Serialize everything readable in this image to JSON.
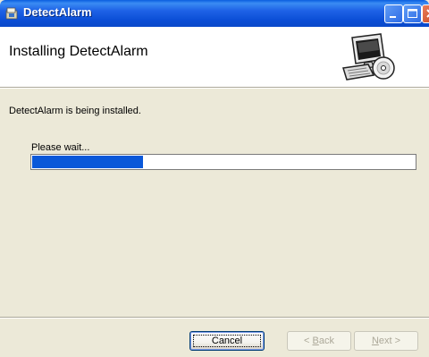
{
  "window": {
    "title": "DetectAlarm"
  },
  "header": {
    "title": "Installing DetectAlarm"
  },
  "body": {
    "status_text": "DetectAlarm is being installed.",
    "wait_label": "Please wait...",
    "progress_fraction": 0.29
  },
  "buttons": {
    "cancel": "Cancel",
    "back_prefix": "< ",
    "back_mnemonic": "B",
    "back_rest": "ack",
    "next_mnemonic": "N",
    "next_rest": "ext >"
  },
  "colors": {
    "titlebar": "#0a5ddf",
    "progress_fill": "#0a58d9",
    "dialog_bg": "#ece9d8"
  },
  "icons": {
    "app": "installer-package-icon",
    "header": "computer-with-cd-icon"
  }
}
